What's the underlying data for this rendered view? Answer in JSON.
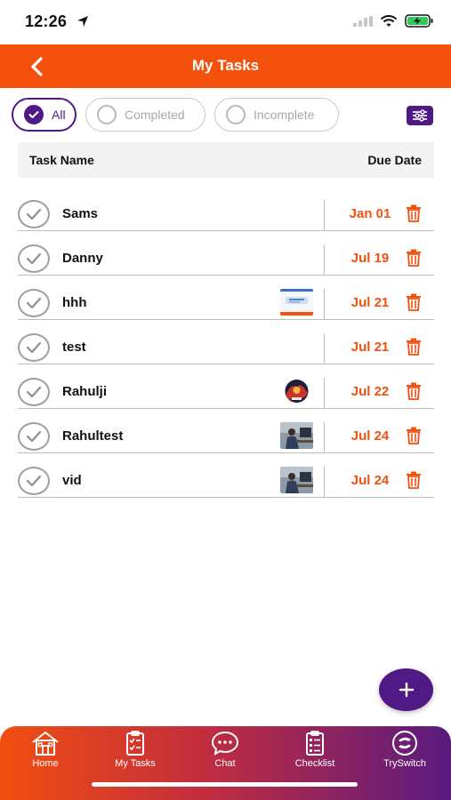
{
  "status_bar": {
    "time": "12:26"
  },
  "header": {
    "title": "My Tasks"
  },
  "filters": [
    {
      "label": "All",
      "active": true
    },
    {
      "label": "Completed",
      "active": false
    },
    {
      "label": "Incomplete",
      "active": false
    }
  ],
  "table": {
    "col_name": "Task Name",
    "col_due": "Due Date"
  },
  "tasks": [
    {
      "name": "Sams",
      "due": "Jan 01",
      "has_attachment": false
    },
    {
      "name": "Danny",
      "due": "Jul 19",
      "has_attachment": false
    },
    {
      "name": "hhh",
      "due": "Jul 21",
      "has_attachment": true
    },
    {
      "name": "test",
      "due": "Jul 21",
      "has_attachment": false
    },
    {
      "name": "Rahulji",
      "due": "Jul 22",
      "has_attachment": true
    },
    {
      "name": "Rahultest",
      "due": "Jul 24",
      "has_attachment": true
    },
    {
      "name": "vid",
      "due": "Jul 24",
      "has_attachment": true
    }
  ],
  "tabbar": {
    "items": [
      {
        "label": "Home",
        "icon": "home-icon"
      },
      {
        "label": "My Tasks",
        "icon": "clipboard-check-icon"
      },
      {
        "label": "Chat",
        "icon": "chat-bubble-icon"
      },
      {
        "label": "Checklist",
        "icon": "checklist-icon"
      },
      {
        "label": "TrySwitch",
        "icon": "tryswitch-logo-icon"
      }
    ]
  },
  "colors": {
    "accent": "#f4500e",
    "primary": "#4f1a86"
  }
}
